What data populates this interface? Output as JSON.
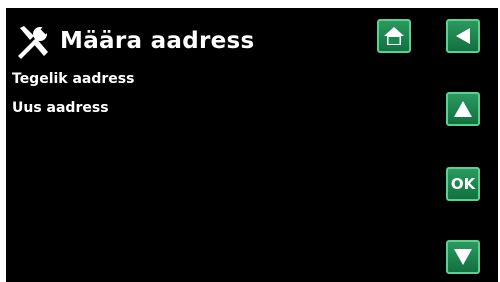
{
  "header": {
    "title": "Määra aadress",
    "tools_icon": "tools-icon"
  },
  "fields": [
    {
      "label": "Tegelik aadress"
    },
    {
      "label": "Uus aadress"
    }
  ],
  "buttons": {
    "home_icon": "home-icon",
    "back_icon": "arrow-left-icon",
    "up_icon": "arrow-up-icon",
    "ok_label": "OK",
    "down_icon": "arrow-down-icon"
  },
  "colors": {
    "background": "#000000",
    "button_green": "#1a8a50",
    "button_border": "#5ccf92",
    "text": "#ffffff"
  }
}
